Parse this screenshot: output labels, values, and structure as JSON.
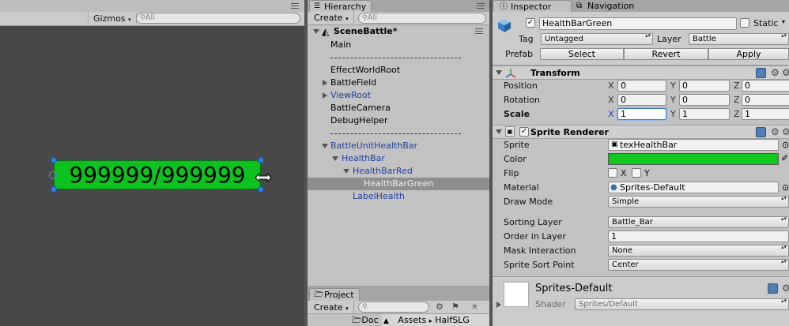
{
  "scene": {
    "gizmos_label": "Gizmos",
    "search_placeholder": "All",
    "health_text": "999999/999999",
    "bar_color": "#0bc21e"
  },
  "hierarchy": {
    "tab_label": "Hierarchy",
    "create_label": "Create",
    "search_placeholder": "All",
    "scene_name": "SceneBattle*",
    "items": [
      {
        "label": "Main",
        "depth": 0
      },
      {
        "label": "EffectWorldRoot",
        "depth": 0
      },
      {
        "label": "BattleField",
        "depth": 0
      },
      {
        "label": "ViewRoot",
        "depth": 0
      },
      {
        "label": "BattleCamera",
        "depth": 0
      },
      {
        "label": "DebugHelper",
        "depth": 0
      },
      {
        "label": "BattleUnitHealthBar",
        "depth": 0
      },
      {
        "label": "HealthBar",
        "depth": 1
      },
      {
        "label": "HealthBarRed",
        "depth": 2
      },
      {
        "label": "HealthBarGreen",
        "depth": 3
      },
      {
        "label": "LabelHealth",
        "depth": 2
      }
    ]
  },
  "project": {
    "tab_label": "Project",
    "create_label": "Create",
    "folder_label": "Doc",
    "breadcrumb": [
      "Assets",
      "HalfSLG"
    ]
  },
  "inspector": {
    "tabs": [
      "Inspector",
      "Navigation"
    ],
    "object_name": "HealthBarGreen",
    "static_label": "Static",
    "tag_label": "Tag",
    "tag_value": "Untagged",
    "layer_label": "Layer",
    "layer_value": "Battle",
    "prefab_label": "Prefab",
    "prefab_buttons": [
      "Select",
      "Revert",
      "Apply"
    ],
    "transform": {
      "title": "Transform",
      "position_label": "Position",
      "rotation_label": "Rotation",
      "scale_label": "Scale",
      "position": {
        "x": "0",
        "y": "0",
        "z": "0"
      },
      "rotation": {
        "x": "0",
        "y": "0",
        "z": "0"
      },
      "scale": {
        "x": "1",
        "y": "1",
        "z": "1"
      }
    },
    "sprite_renderer": {
      "title": "Sprite Renderer",
      "sprite_label": "Sprite",
      "sprite_value": "texHealthBar",
      "color_label": "Color",
      "color_value": "#10c81e",
      "flip_label": "Flip",
      "flip_x": "X",
      "flip_y": "Y",
      "material_label": "Material",
      "material_value": "Sprites-Default",
      "draw_mode_label": "Draw Mode",
      "draw_mode_value": "Simple",
      "sorting_layer_label": "Sorting Layer",
      "sorting_layer_value": "Battle_Bar",
      "order_label": "Order in Layer",
      "order_value": "1",
      "mask_label": "Mask Interaction",
      "mask_value": "None",
      "sort_point_label": "Sprite Sort Point",
      "sort_point_value": "Center"
    },
    "material": {
      "name": "Sprites-Default",
      "shader_label": "Shader",
      "shader_value": "Sprites/Default"
    }
  }
}
